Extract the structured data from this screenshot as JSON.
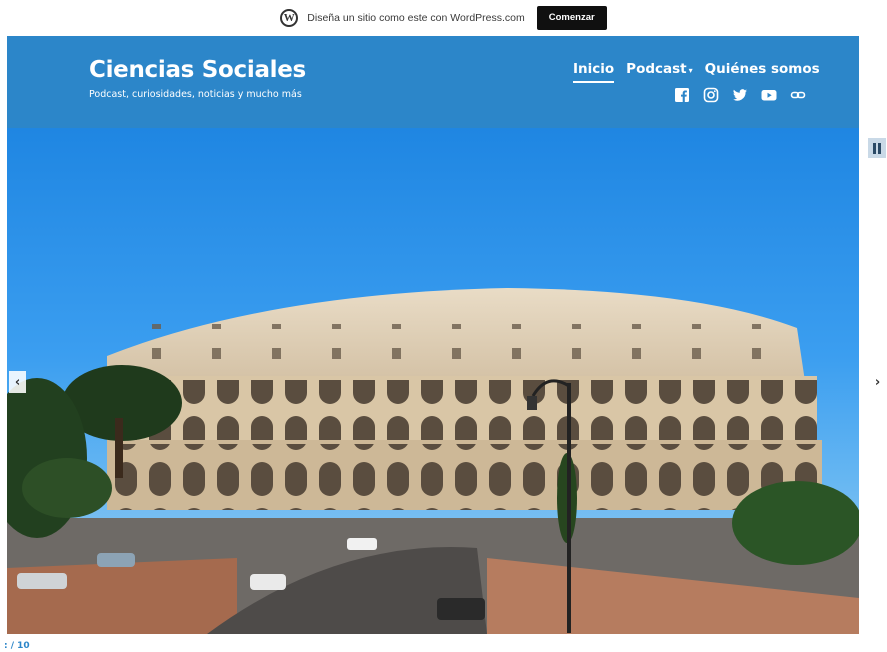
{
  "promo": {
    "logo_icon": "wordpress-icon",
    "text": "Diseña un sitio como este con WordPress.com",
    "button_label": "Comenzar"
  },
  "header": {
    "site_title": "Ciencias Sociales",
    "tagline": "Podcast, curiosidades, noticias y mucho más",
    "background_color": "#2c86c9",
    "nav": [
      {
        "label": "Inicio",
        "active": true
      },
      {
        "label": "Podcast",
        "has_dropdown": true
      },
      {
        "label": "Quiénes somos"
      }
    ],
    "social_icons": [
      "facebook-icon",
      "instagram-icon",
      "twitter-icon",
      "youtube-icon",
      "link-icon"
    ]
  },
  "slider": {
    "counter": ": / 10",
    "controls": [
      "pause-icon",
      "prev-arrow-icon",
      "next-arrow-icon"
    ]
  }
}
